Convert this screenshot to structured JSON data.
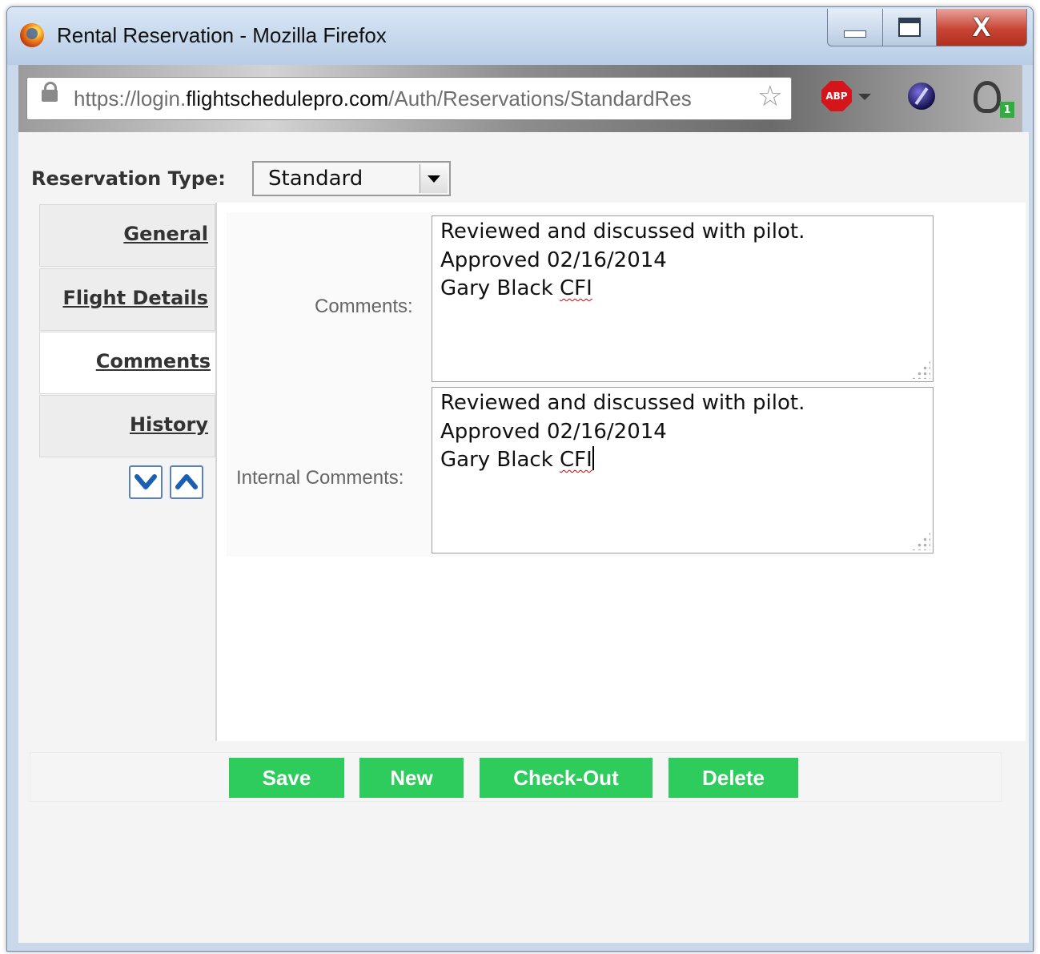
{
  "window": {
    "title": "Rental Reservation - Mozilla Firefox",
    "close_glyph": "X"
  },
  "browser": {
    "url_prefix": "https://login.",
    "url_domain": "flightschedulepro.com",
    "url_path": "/Auth/Reservations/StandardRes",
    "abp_label": "ABP",
    "badge_count": "1",
    "icons": [
      "firefox-icon",
      "lock-icon",
      "star-icon",
      "adblock-icon",
      "extension-icon",
      "ghostery-icon"
    ]
  },
  "reservation": {
    "type_label": "Reservation Type:",
    "type_value": "Standard"
  },
  "tabs": [
    {
      "label": "General",
      "active": false
    },
    {
      "label": "Flight Details",
      "active": false
    },
    {
      "label": "Comments",
      "active": true
    },
    {
      "label": "History",
      "active": false
    }
  ],
  "form": {
    "comments_label": "Comments:",
    "comments_lines": [
      "Reviewed and discussed with pilot.",
      "Approved 02/16/2014",
      "Gary Black ",
      "CFI"
    ],
    "internal_label": "Internal Comments:",
    "internal_lines": [
      "Reviewed and discussed with pilot.",
      "Approved 02/16/2014",
      "Gary Black ",
      "CFI"
    ]
  },
  "actions": {
    "save": "Save",
    "new": "New",
    "checkout": "Check-Out",
    "delete": "Delete"
  },
  "colors": {
    "button_green": "#2ecc5c",
    "close_red": "#c94535",
    "spell_underline": "#d40000"
  }
}
